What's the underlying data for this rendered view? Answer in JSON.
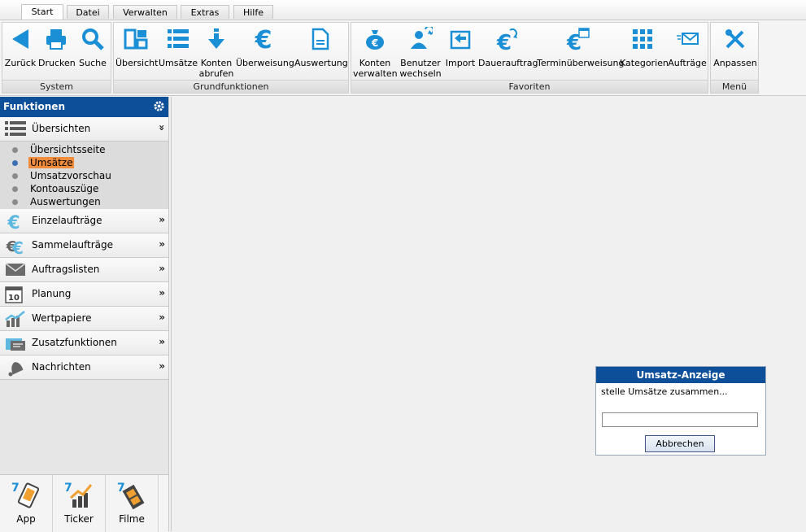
{
  "tabs": [
    {
      "label": "Start",
      "active": true
    },
    {
      "label": "Datei",
      "active": false
    },
    {
      "label": "Verwalten",
      "active": false
    },
    {
      "label": "Extras",
      "active": false
    },
    {
      "label": "Hilfe",
      "active": false
    }
  ],
  "ribbon": {
    "groups": [
      {
        "label": "System",
        "buttons": [
          {
            "label": "Zurück",
            "icon": "back-arrow-icon"
          },
          {
            "label": "Drucken",
            "icon": "printer-icon"
          },
          {
            "label": "Suche",
            "icon": "search-icon"
          }
        ]
      },
      {
        "label": "Grundfunktionen",
        "buttons": [
          {
            "label": "Übersicht",
            "icon": "overview-icon"
          },
          {
            "label": "Umsätze",
            "icon": "list-icon"
          },
          {
            "label": "Konten abrufen",
            "icon": "download-arrow-icon"
          },
          {
            "label": "Überweisung",
            "icon": "euro-icon"
          },
          {
            "label": "Auswertung",
            "icon": "document-icon"
          }
        ]
      },
      {
        "label": "Favoriten",
        "buttons": [
          {
            "label": "Konten verwalten",
            "icon": "money-bag-icon"
          },
          {
            "label": "Benutzer wechseln",
            "icon": "user-switch-icon"
          },
          {
            "label": "Import",
            "icon": "import-icon"
          },
          {
            "label": "Dauerauftrag",
            "icon": "euro-refresh-icon"
          },
          {
            "label": "Terminüberweisung",
            "icon": "euro-calendar-icon"
          },
          {
            "label": "Kategorien",
            "icon": "grid-icon"
          },
          {
            "label": "Aufträge",
            "icon": "envelope-icon"
          }
        ]
      },
      {
        "label": "Menü",
        "buttons": [
          {
            "label": "Anpassen",
            "icon": "tools-icon"
          }
        ]
      }
    ]
  },
  "panel": {
    "title": "Funktionen",
    "categories": [
      {
        "label": "Übersichten",
        "icon": "list-icon",
        "expanded": true,
        "items": [
          {
            "label": "Übersichtsseite"
          },
          {
            "label": "Umsätze",
            "selected": true
          },
          {
            "label": "Umsatzvorschau"
          },
          {
            "label": "Kontoauszüge"
          },
          {
            "label": "Auswertungen"
          }
        ]
      },
      {
        "label": "Einzelaufträge",
        "icon": "euro-icon"
      },
      {
        "label": "Sammelaufträge",
        "icon": "euro-stack-icon"
      },
      {
        "label": "Auftragslisten",
        "icon": "envelope-icon"
      },
      {
        "label": "Planung",
        "icon": "calendar-icon"
      },
      {
        "label": "Wertpapiere",
        "icon": "chart-icon"
      },
      {
        "label": "Zusatzfunktionen",
        "icon": "card-icon"
      },
      {
        "label": "Nachrichten",
        "icon": "bell-icon"
      }
    ],
    "chev_expanded": "»",
    "chev_collapsed": "»"
  },
  "apps": [
    {
      "label": "App"
    },
    {
      "label": "Ticker"
    },
    {
      "label": "Filme"
    }
  ],
  "dialog": {
    "title": "Umsatz-Anzeige",
    "message": "stelle Umsätze zusammen...",
    "button": "Abbrechen",
    "progress": 0
  },
  "colors": {
    "accent": "#0e4f9a",
    "icon": "#1b8fd6",
    "selection": "#f08c3c"
  }
}
